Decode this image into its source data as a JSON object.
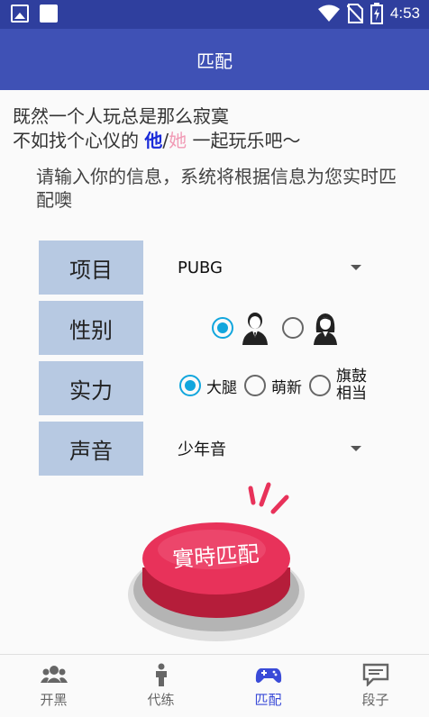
{
  "status_bar": {
    "time": "4:53",
    "icons": [
      "image-icon",
      "square-icon",
      "wifi-icon",
      "no-sim-icon",
      "battery-charging-icon"
    ]
  },
  "app_bar": {
    "title": "匹配"
  },
  "intro": {
    "line1": "既然一个人玩总是那么寂寞",
    "line2_prefix": "不如找个心仪的 ",
    "he": "他",
    "slash": "/",
    "she": "她",
    "line2_suffix": " 一起玩乐吧～"
  },
  "description": "请输入你的信息，系统将根据信息为您实时匹配噢",
  "form": {
    "game": {
      "label": "项目",
      "value": "PUBG"
    },
    "gender": {
      "label": "性别",
      "selected": "male",
      "options": [
        "male-avatar-icon",
        "female-avatar-icon"
      ]
    },
    "skill": {
      "label": "实力",
      "options": [
        "大腿",
        "萌新",
        "旗鼓相当"
      ],
      "option3_line1": "旗鼓",
      "option3_line2": "相当",
      "selected": 0
    },
    "voice": {
      "label": "声音",
      "value": "少年音"
    }
  },
  "match_button": {
    "label": "實時匹配",
    "color": "#e8325a"
  },
  "tabs": [
    {
      "label": "开黑",
      "icon": "group-icon",
      "active": false
    },
    {
      "label": "代练",
      "icon": "person-icon",
      "active": false
    },
    {
      "label": "匹配",
      "icon": "gamepad-icon",
      "active": true
    },
    {
      "label": "段子",
      "icon": "chat-icon",
      "active": false
    }
  ],
  "colors": {
    "primary": "#3f51b5",
    "status_bar": "#2f3f9e",
    "label_bg": "#b7c9e2",
    "radio": "#11a6dd",
    "active_tab": "#3a4bd8"
  }
}
